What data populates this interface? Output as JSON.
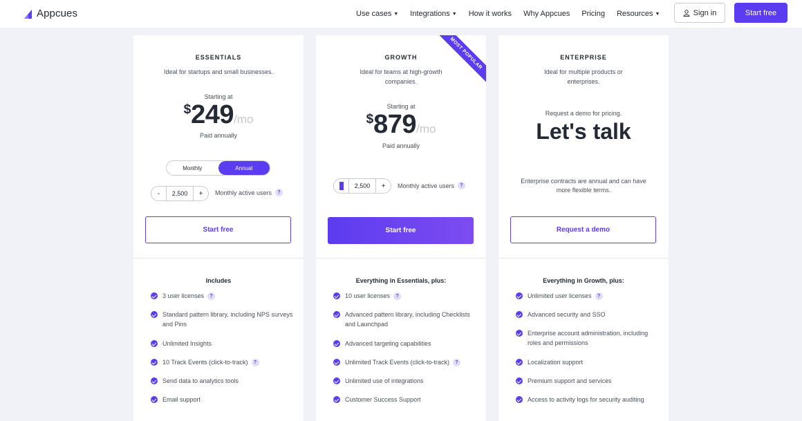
{
  "brand": {
    "name": "Appcues",
    "accent": "#5c3cf0"
  },
  "nav": {
    "links": [
      {
        "label": "Use cases",
        "dropdown": true
      },
      {
        "label": "Integrations",
        "dropdown": true
      },
      {
        "label": "How it works",
        "dropdown": false
      },
      {
        "label": "Why Appcues",
        "dropdown": false
      },
      {
        "label": "Pricing",
        "dropdown": false
      },
      {
        "label": "Resources",
        "dropdown": true
      }
    ],
    "sign_in": "Sign in",
    "start_free": "Start free"
  },
  "plans": {
    "essentials": {
      "name": "ESSENTIALS",
      "description": "Ideal for startups and small businesses.",
      "starting_at": "Starting at",
      "currency": "$",
      "price": "249",
      "per": "/mo",
      "billing": "Paid annually",
      "toggle": {
        "monthly": "Monthly",
        "annual": "Annual",
        "selected": "Annual"
      },
      "mau_value": "2,500",
      "mau_label": "Monthly active users",
      "cta": "Start free",
      "features_heading": "Includes",
      "features": [
        {
          "text": "3 user licenses",
          "help": true
        },
        {
          "text": "Standard pattern library, including NPS surveys and Pins",
          "help": false
        },
        {
          "text": "Unlimited Insights",
          "help": false
        },
        {
          "text": "10 Track Events (click-to-track)",
          "help": true
        },
        {
          "text": "Send data to analytics tools",
          "help": false
        },
        {
          "text": "Email support",
          "help": false
        }
      ]
    },
    "growth": {
      "name": "GROWTH",
      "badge": "MOST POPULAR",
      "description": "Ideal for teams at high-growth companies.",
      "starting_at": "Starting at",
      "currency": "$",
      "price": "879",
      "per": "/mo",
      "billing": "Paid annually",
      "mau_value": "2,500",
      "mau_label": "Monthly active users",
      "cta": "Start free",
      "features_heading": "Everything in Essentials, plus:",
      "features": [
        {
          "text": "10 user licenses",
          "help": true
        },
        {
          "text": "Advanced pattern library, including Checklists and Launchpad",
          "help": false
        },
        {
          "text": "Advanced targeting capabilities",
          "help": false
        },
        {
          "text": "Unlimited Track Events (click-to-track)",
          "help": true
        },
        {
          "text": "Unlimited use of integrations",
          "help": false
        },
        {
          "text": "Customer Success Support",
          "help": false
        }
      ]
    },
    "enterprise": {
      "name": "ENTERPRISE",
      "description": "Ideal for multiple products or enterprises.",
      "request_note": "Request a demo for pricing.",
      "headline": "Let's talk",
      "contract_note": "Enterprise contracts are annual and can have more flexible terms.",
      "cta": "Request a demo",
      "features_heading": "Everything in Growth, plus:",
      "features": [
        {
          "text": "Unlimited user licenses",
          "help": true
        },
        {
          "text": "Advanced security and SSO",
          "help": false
        },
        {
          "text": "Enterprise account administration, including roles and permissions",
          "help": false
        },
        {
          "text": "Localization support",
          "help": false
        },
        {
          "text": "Premium support and services",
          "help": false
        },
        {
          "text": "Access to activity logs for security auditing",
          "help": false
        }
      ]
    }
  }
}
